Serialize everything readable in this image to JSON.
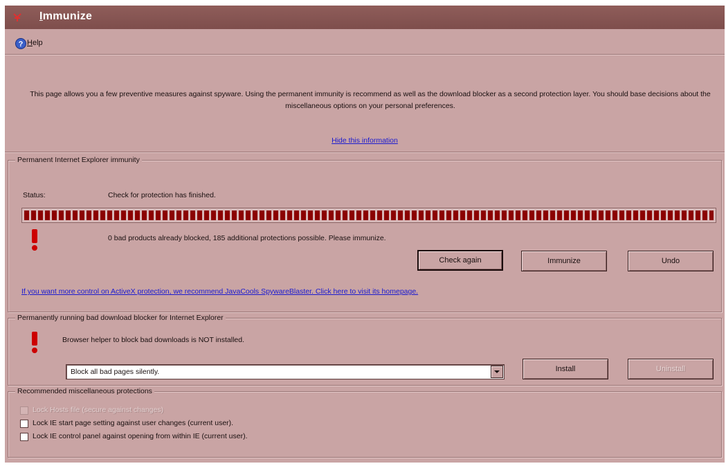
{
  "window": {
    "title_prefix": "I",
    "title_rest": "mmunize",
    "app_icon": "spybot-icon"
  },
  "menu": {
    "help_label": "Help",
    "help_icon": "help-icon"
  },
  "info": {
    "text": "This page allows you a few preventive measures against spyware. Using the permanent immunity is recommend as well as the download blocker as a second protection layer. You should base decisions about the miscellaneous options on your personal preferences.",
    "hide_link": "Hide this information"
  },
  "immunity": {
    "group_title": "Permanent Internet Explorer immunity",
    "status_label": "Status:",
    "status_value": "Check for protection has finished.",
    "progress": 1.0,
    "message": "0 bad products already blocked, 185 additional protections possible. Please immunize.",
    "check_again_label": "Check again",
    "immunize_label": "Immunize",
    "undo_label": "Undo",
    "spywareblaster_link": "If you want more control on ActiveX protection, we recommend JavaCools SpywareBlaster. Click here to visit its homepage."
  },
  "download_blocker": {
    "group_title": "Permanently running bad download blocker for Internet Explorer",
    "message": "Browser helper to block bad downloads is NOT installed.",
    "select_value": "Block all bad pages silently.",
    "install_label": "Install",
    "uninstall_label": "Uninstall"
  },
  "misc": {
    "group_title": "Recommended miscellaneous protections",
    "items": [
      {
        "label": "Lock Hosts file (secure against changes)",
        "checked": false,
        "disabled": true
      },
      {
        "label": "Lock IE start page setting against user changes (current user).",
        "checked": false,
        "disabled": false
      },
      {
        "label": "Lock IE control panel against opening from within IE (current user).",
        "checked": false,
        "disabled": false
      }
    ]
  },
  "colors": {
    "window_bg": "#c9a4a4",
    "titlebar": "#7e4e4c",
    "progress": "#8b0000",
    "warning": "#cc0000",
    "link": "#1a1ad0"
  }
}
